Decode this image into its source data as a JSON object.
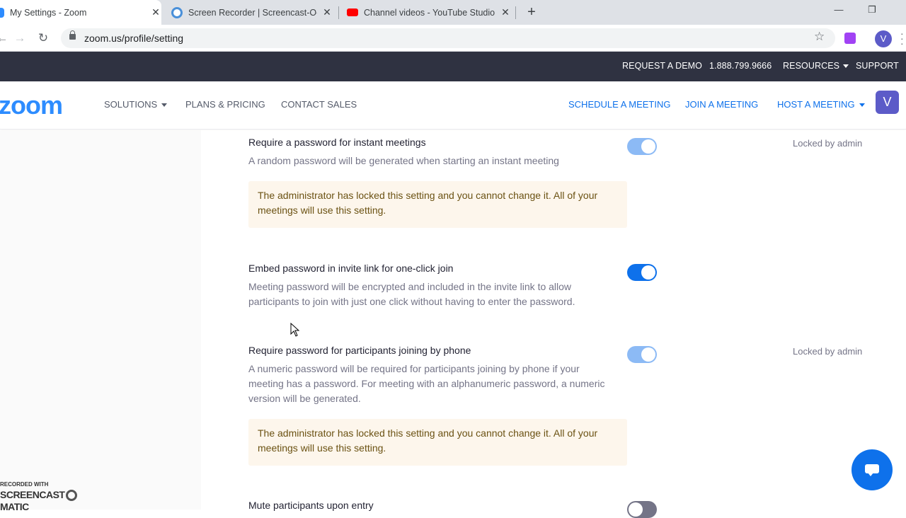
{
  "browser": {
    "tabs": [
      {
        "title": "My Settings - Zoom",
        "active": true
      },
      {
        "title": "Screen Recorder | Screencast-O-M",
        "active": false
      },
      {
        "title": "Channel videos - YouTube Studio",
        "active": false
      }
    ],
    "url": "zoom.us/profile/setting",
    "profile_initial": "V",
    "icons": {
      "close": "close-icon",
      "new_tab": "plus-icon",
      "back": "back-arrow-icon",
      "forward": "forward-arrow-icon",
      "reload": "reload-icon",
      "lock": "lock-icon",
      "bookmark": "star-icon"
    }
  },
  "topbar": {
    "request_demo": "REQUEST A DEMO",
    "phone": "1.888.799.9666",
    "resources": "RESOURCES",
    "support": "SUPPORT"
  },
  "mainnav": {
    "logo": "zoom",
    "solutions": "SOLUTIONS",
    "plans": "PLANS & PRICING",
    "contact": "CONTACT SALES",
    "schedule": "SCHEDULE A MEETING",
    "join": "JOIN A MEETING",
    "host": "HOST A MEETING",
    "avatar_initial": "V"
  },
  "settings": [
    {
      "title": "Require a password for instant meetings",
      "description": "A random password will be generated when starting an instant meeting",
      "locked_label": "Locked by admin",
      "notice": "The administrator has locked this setting and you cannot change it. All of your meetings will use this setting.",
      "toggle": "on-locked"
    },
    {
      "title": "Embed password in invite link for one-click join",
      "description": "Meeting password will be encrypted and included in the invite link to allow participants to join with just one click without having to enter the password.",
      "toggle": "on"
    },
    {
      "title": "Require password for participants joining by phone",
      "description": "A numeric password will be required for participants joining by phone if your meeting has a password. For meeting with an alphanumeric password, a numeric version will be generated.",
      "locked_label": "Locked by admin",
      "notice": "The administrator has locked this setting and you cannot change it. All of your meetings will use this setting.",
      "toggle": "on-locked"
    },
    {
      "title": "Mute participants upon entry",
      "toggle": "off"
    }
  ],
  "watermark": {
    "small": "RECORDED WITH",
    "big_left": "SCREENCAST",
    "big_right": "MATIC"
  },
  "colors": {
    "brand": "#2d8cff",
    "link_blue": "#0e71eb",
    "topbar_bg": "#2f3241",
    "notice_bg": "#fdf6ec"
  }
}
